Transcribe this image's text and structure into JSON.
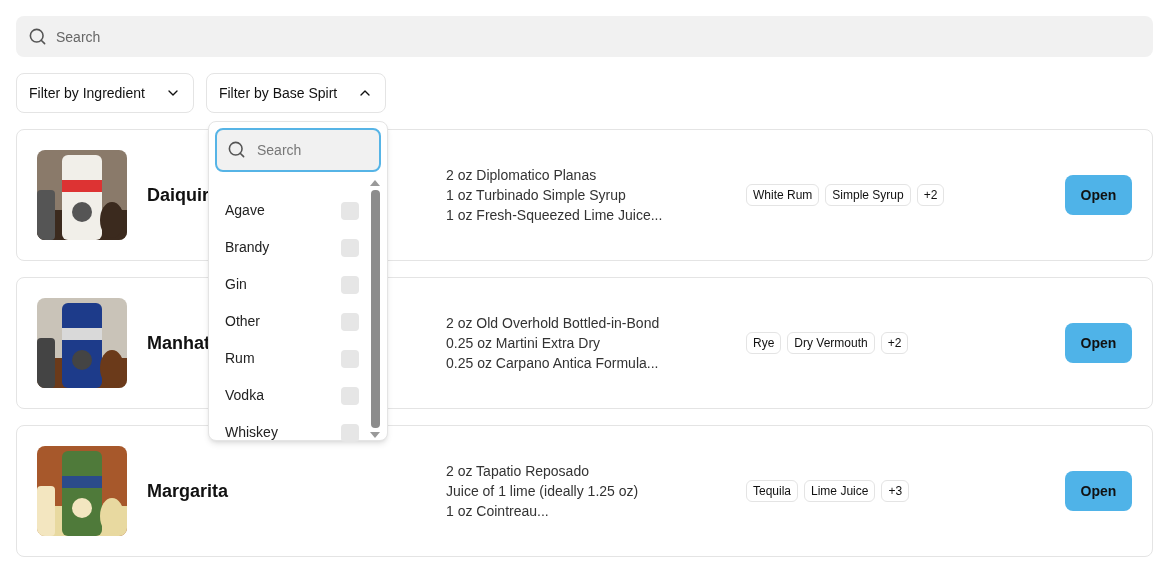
{
  "search": {
    "placeholder": "Search"
  },
  "filters": [
    {
      "label": "Filter by Ingredient",
      "expanded": false
    },
    {
      "label": "Filter by Base Spirt",
      "expanded": true
    }
  ],
  "dropdown": {
    "search": {
      "placeholder": "Search"
    },
    "options": [
      {
        "label": "Agave",
        "checked": false
      },
      {
        "label": "Brandy",
        "checked": false
      },
      {
        "label": "Gin",
        "checked": false
      },
      {
        "label": "Other",
        "checked": false
      },
      {
        "label": "Rum",
        "checked": false
      },
      {
        "label": "Vodka",
        "checked": false
      },
      {
        "label": "Whiskey",
        "checked": false
      }
    ]
  },
  "cocktails": [
    {
      "name": "Daiquir",
      "ingredients": [
        "2 oz Diplomatico Planas",
        "1 oz Turbinado Simple Syrup",
        "1 oz Fresh-Squeezed Lime Juice..."
      ],
      "tags": [
        "White Rum",
        "Simple Syrup",
        "+2"
      ],
      "button": "Open"
    },
    {
      "name": "Manhat",
      "ingredients": [
        "2 oz Old Overhold Bottled-in-Bond",
        "0.25 oz Martini Extra Dry",
        "0.25 oz Carpano Antica Formula..."
      ],
      "tags": [
        "Rye",
        "Dry Vermouth",
        "+2"
      ],
      "button": "Open"
    },
    {
      "name": "Margarita",
      "ingredients": [
        "2 oz Tapatio Reposado",
        "Juice of 1 lime (ideally 1.25 oz)",
        "1 oz Cointreau..."
      ],
      "tags": [
        "Tequila",
        "Lime Juice",
        "+3"
      ],
      "button": "Open"
    }
  ]
}
